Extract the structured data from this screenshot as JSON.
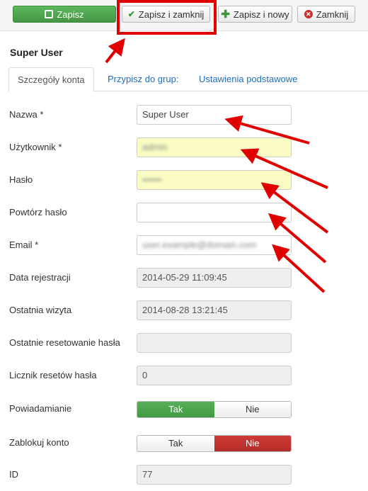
{
  "toolbar": {
    "save_label": "Zapisz",
    "save_close_label": "Zapisz i zamknij",
    "save_new_label": "Zapisz i nowy",
    "close_label": "Zamknij"
  },
  "page_title": "Super User",
  "tabs": [
    {
      "label": "Szczegóły konta",
      "active": true
    },
    {
      "label": "Przypisz do grup:",
      "active": false
    },
    {
      "label": "Ustawienia podstawowe",
      "active": false
    }
  ],
  "fields": {
    "name": {
      "label": "Nazwa *",
      "value": "Super User"
    },
    "username": {
      "label": "Użytkownik *",
      "value": "admin"
    },
    "password": {
      "label": "Hasło",
      "value": "••••••"
    },
    "password2": {
      "label": "Powtórz hasło",
      "value": ""
    },
    "email": {
      "label": "Email *",
      "value": "user.example@domain.com"
    },
    "register_date": {
      "label": "Data rejestracji",
      "value": "2014-05-29 11:09:45"
    },
    "last_visit": {
      "label": "Ostatnia wizyta",
      "value": "2014-08-28 13:21:45"
    },
    "last_reset": {
      "label": "Ostatnie resetowanie hasła",
      "value": ""
    },
    "reset_count": {
      "label": "Licznik resetów hasła",
      "value": "0"
    },
    "notify": {
      "label": "Powiadamianie",
      "yes": "Tak",
      "no": "Nie",
      "selected": "Tak"
    },
    "block": {
      "label": "Zablokuj konto",
      "yes": "Tak",
      "no": "Nie",
      "selected": "Nie"
    },
    "id": {
      "label": "ID",
      "value": "77"
    }
  },
  "colors": {
    "save_green": "#5cb85c",
    "highlight_red": "#e10000",
    "autofill_yellow": "#fafcc4",
    "toggle_red": "#c9302c"
  }
}
